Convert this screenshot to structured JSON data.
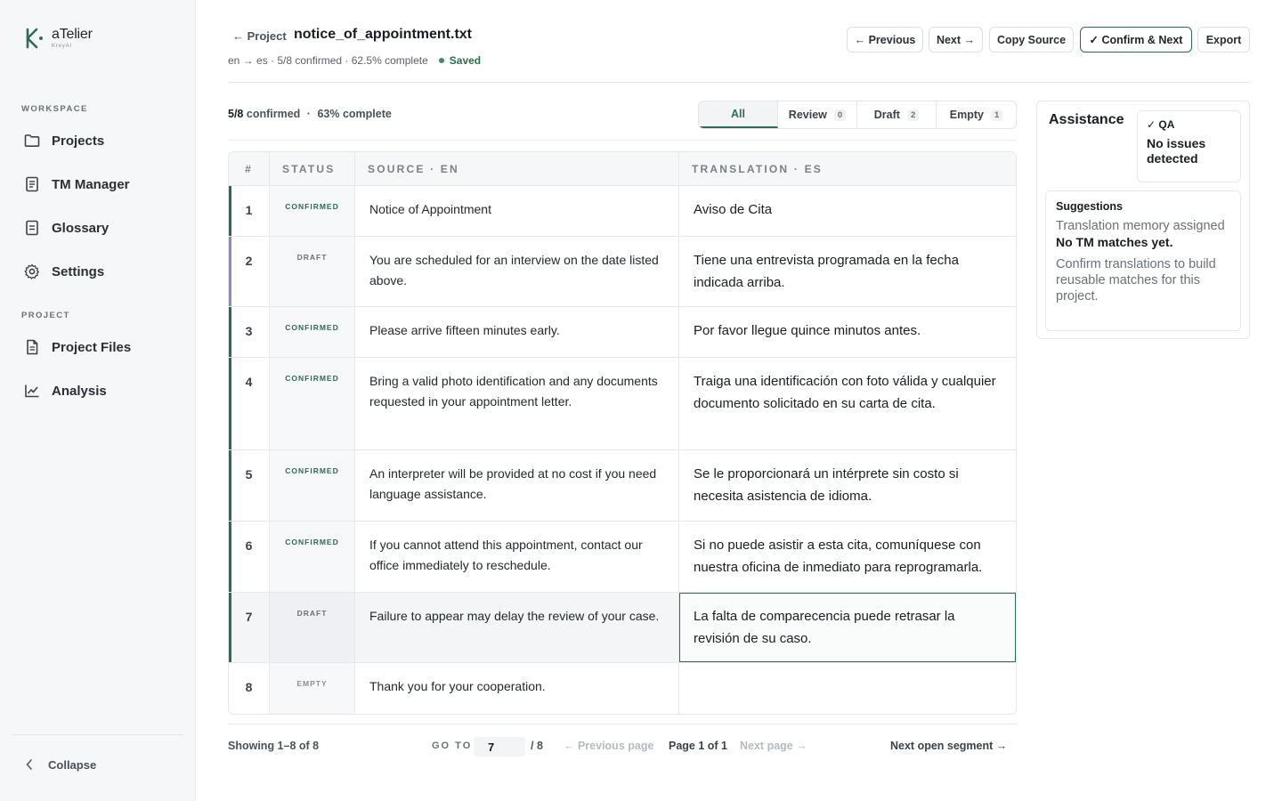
{
  "app": {
    "name": "aTelier",
    "sub": "KreyAI"
  },
  "sidebar": {
    "workspace_label": "WORKSPACE",
    "workspace_items": [
      {
        "label": "Projects",
        "icon": "folder-icon"
      },
      {
        "label": "TM Manager",
        "icon": "document-icon"
      },
      {
        "label": "Glossary",
        "icon": "book-icon"
      },
      {
        "label": "Settings",
        "icon": "gear-icon"
      }
    ],
    "project_label": "PROJECT",
    "project_items": [
      {
        "label": "Project Files",
        "icon": "file-icon"
      },
      {
        "label": "Analysis",
        "icon": "chart-icon"
      }
    ],
    "collapse_label": "Collapse"
  },
  "header": {
    "back_label": "← Project",
    "file_name": "notice_of_appointment.txt",
    "meta": "en → es · 5/8 confirmed · 62.5% complete",
    "saved": "Saved",
    "buttons": {
      "previous": "← Previous",
      "next": "Next →",
      "copy_source": "Copy Source",
      "confirm_next": "✓ Confirm & Next",
      "export": "Export"
    }
  },
  "progress": {
    "count": "5/8",
    "confirmed_label": "confirmed",
    "sep": "·",
    "percent": "63% complete"
  },
  "filters": [
    {
      "label": "All",
      "count": null,
      "active": true
    },
    {
      "label": "Review",
      "count": "0"
    },
    {
      "label": "Draft",
      "count": "2"
    },
    {
      "label": "Empty",
      "count": "1"
    }
  ],
  "table": {
    "headers": {
      "num": "#",
      "status": "STATUS",
      "source": "SOURCE · EN",
      "translation": "TRANSLATION · ES"
    },
    "rows": [
      {
        "num": "1",
        "status": "CONFIRMED",
        "source": "Notice of Appointment",
        "translation": "Aviso de Cita"
      },
      {
        "num": "2",
        "status": "DRAFT",
        "source": "You are scheduled for an interview on the date listed above.",
        "translation": "Tiene una entrevista programada en la fecha indicada arriba."
      },
      {
        "num": "3",
        "status": "CONFIRMED",
        "source": "Please arrive fifteen minutes early.",
        "translation": "Por favor llegue quince minutos antes."
      },
      {
        "num": "4",
        "status": "CONFIRMED",
        "source": "Bring a valid photo identification and any documents requested in your appointment letter.",
        "translation": "Traiga una identificación con foto válida y cualquier documento solicitado en su carta de cita."
      },
      {
        "num": "5",
        "status": "CONFIRMED",
        "source": "An interpreter will be provided at no cost if you need language assistance.",
        "translation": "Se le proporcionará un intérprete sin costo si necesita asistencia de idioma."
      },
      {
        "num": "6",
        "status": "CONFIRMED",
        "source": "If you cannot attend this appointment, contact our office immediately to reschedule.",
        "translation": "Si no puede asistir a esta cita, comuníquese con nuestra oficina de inmediato para reprogramarla."
      },
      {
        "num": "7",
        "status": "DRAFT",
        "source": "Failure to appear may delay the review of your case.",
        "translation": "La falta de comparecencia puede retrasar la revisión de su caso.",
        "selected": true
      },
      {
        "num": "8",
        "status": "EMPTY",
        "source": "Thank you for your cooperation.",
        "translation": ""
      }
    ]
  },
  "pager": {
    "showing": "Showing 1–8 of 8",
    "goto_label": "GO TO",
    "goto_value": "7",
    "goto_total": "/ 8",
    "prev_page": "← Previous page",
    "page_of": "Page 1 of 1",
    "next_page": "Next page →",
    "next_open": "Next open segment →"
  },
  "assistance": {
    "title": "Assistance",
    "qa_title": "✓ QA",
    "qa_msg": "No issues detected",
    "suggestions_title": "Suggestions",
    "tm_assigned": "Translation memory assigned",
    "tm_none": "No TM matches yet.",
    "tm_hint": "Confirm translations to build reusable matches for this project."
  },
  "colors": {
    "accent": "#2f6b52",
    "confirmed": "#2f6b52",
    "draft": "#6b7178",
    "empty": "#8a9097",
    "draft_bar": "#8a8fb5"
  }
}
